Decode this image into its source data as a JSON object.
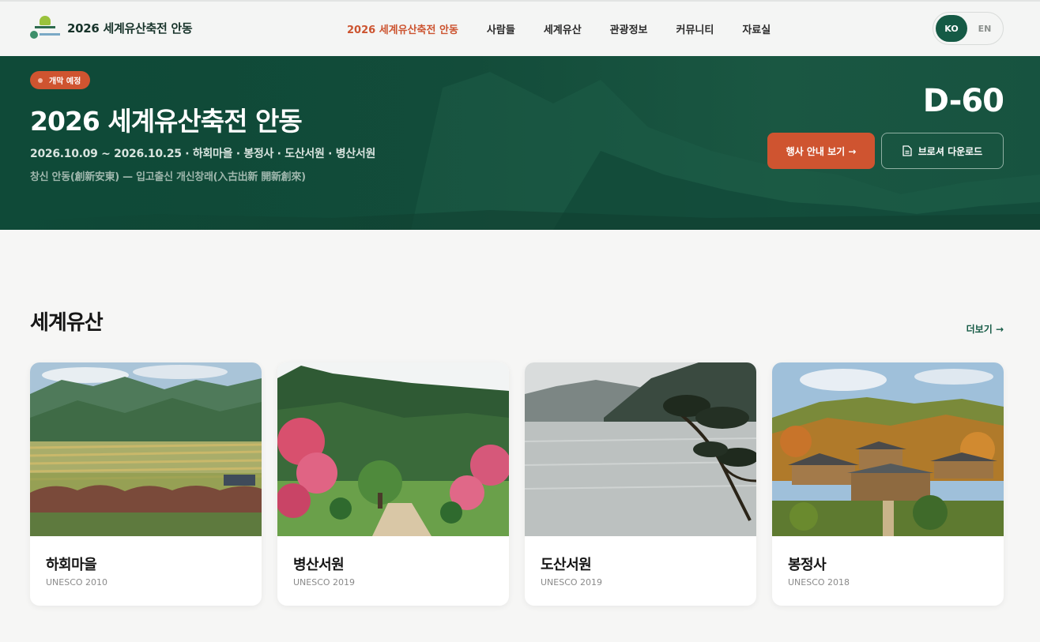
{
  "header": {
    "logo_text": "2026 세계유산축전 안동",
    "nav": [
      {
        "label": "2026 세계유산축전 안동",
        "active": true
      },
      {
        "label": "사람들",
        "active": false
      },
      {
        "label": "세계유산",
        "active": false
      },
      {
        "label": "관광정보",
        "active": false
      },
      {
        "label": "커뮤니티",
        "active": false
      },
      {
        "label": "자료실",
        "active": false
      }
    ],
    "lang": {
      "active": "KO",
      "other": "EN"
    }
  },
  "hero": {
    "badge": "개막 예정",
    "title": "2026 세계유산축전 안동",
    "dates": "2026.10.09 ~ 2026.10.25 · 하회마을 · 봉정사 · 도산서원 · 병산서원",
    "motto": "창신 안동(創新安東) — 입고출신 개신창래(入古出新 開新創來)",
    "dday": "D-60",
    "primary_button": "행사 안내 보기 →",
    "secondary_button": "브로셔 다운로드"
  },
  "section": {
    "title": "세계유산",
    "more": "더보기 →",
    "cards": [
      {
        "name": "하회마을",
        "meta": "UNESCO 2010"
      },
      {
        "name": "병산서원",
        "meta": "UNESCO 2019"
      },
      {
        "name": "도산서원",
        "meta": "UNESCO 2019"
      },
      {
        "name": "봉정사",
        "meta": "UNESCO 2018"
      }
    ]
  },
  "colors": {
    "brand_green": "#155a45",
    "accent_orange": "#cf5430",
    "hero_bg": "#134c3a"
  }
}
